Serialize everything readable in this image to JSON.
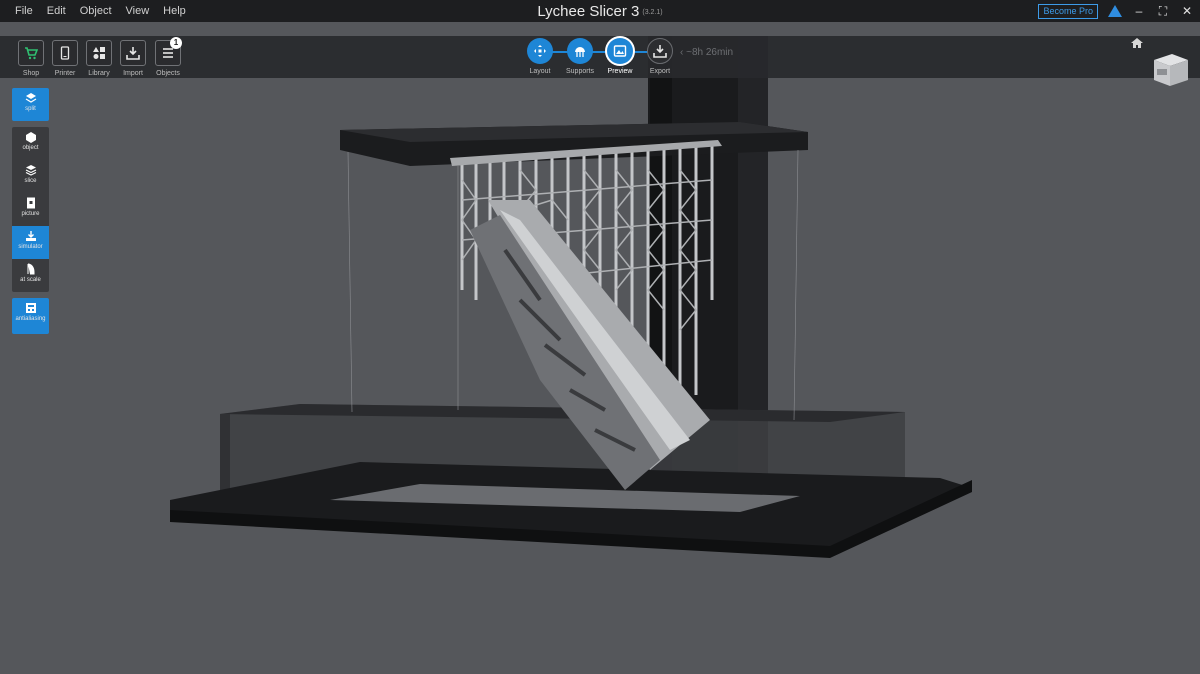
{
  "menu": {
    "items": [
      "File",
      "Edit",
      "Object",
      "View",
      "Help"
    ]
  },
  "window": {
    "title": "Lychee Slicer 3",
    "version": "(3.2.1)",
    "become_pro": "Become Pro",
    "minimize": "–",
    "maximize": "⛶",
    "close": "✕"
  },
  "toolbar": {
    "shop": "Shop",
    "printer": "Printer",
    "library": "Library",
    "import": "Import",
    "objects": "Objects",
    "objects_count": "1"
  },
  "workflow": {
    "layout": "Layout",
    "supports": "Supports",
    "preview": "Preview",
    "export": "Export",
    "eta": "~8h 26min",
    "active": "Preview"
  },
  "sidebar": {
    "split": "split",
    "object": "object",
    "slice": "slice",
    "picture": "picture",
    "simulator": "simulator",
    "at_scale": "at scale",
    "antialiasing": "antialiasing"
  },
  "colors": {
    "accent": "#1e86d6",
    "background": "#55575b",
    "printer_dark": "#1b1c1e",
    "model": "#b4b6b9"
  },
  "icons": [
    "cart-icon",
    "printer-icon",
    "library-icon",
    "import-icon",
    "list-icon",
    "layout-icon",
    "supports-icon",
    "preview-icon",
    "export-icon",
    "home-icon",
    "view-cube-icon",
    "warning-icon"
  ]
}
